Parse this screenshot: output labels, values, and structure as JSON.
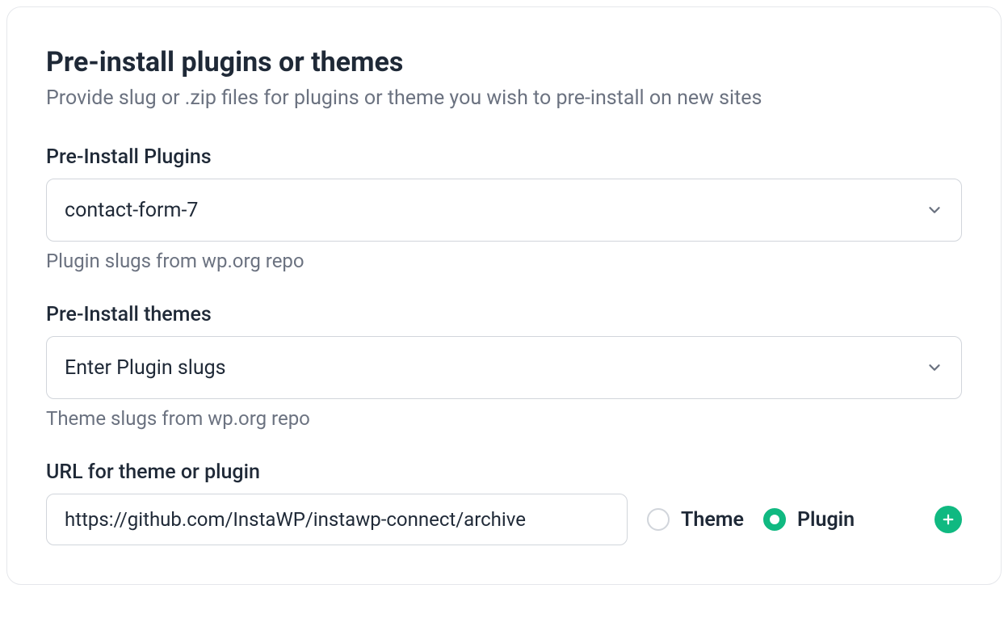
{
  "header": {
    "title": "Pre-install plugins or themes",
    "subtitle": "Provide slug or .zip files for plugins or theme you wish to pre-install on new sites"
  },
  "plugins": {
    "label": "Pre-Install Plugins",
    "value": "contact-form-7",
    "help": "Plugin slugs from wp.org repo"
  },
  "themes": {
    "label": "Pre-Install themes",
    "placeholder": "Enter Plugin slugs",
    "help": "Theme slugs from wp.org repo"
  },
  "url": {
    "label": "URL for theme or plugin",
    "value": "https://github.com/InstaWP/instawp-connect/archive",
    "radio_theme": "Theme",
    "radio_plugin": "Plugin",
    "selected": "plugin"
  },
  "colors": {
    "accent": "#10b981",
    "text": "#1f2937",
    "muted": "#6b7280",
    "border": "#d1d5db"
  }
}
